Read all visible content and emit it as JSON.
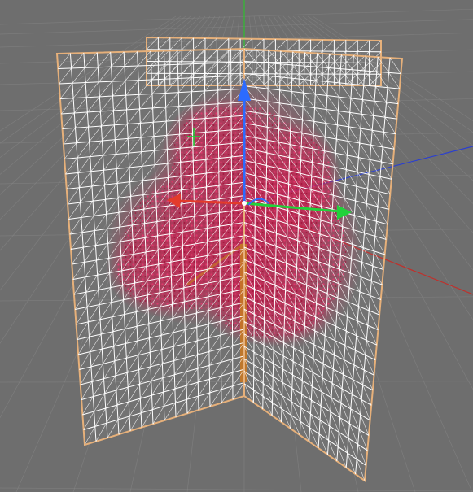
{
  "viewport": {
    "projection": "perspective",
    "background_color": "#6e6e6e",
    "floor_grid": true,
    "floor_grid_color": "#8a8a8a",
    "scene_axes": {
      "x_color": "#c0302b",
      "y_color": "#2fbf2f",
      "z_color": "#2b3fd0"
    }
  },
  "object": {
    "type": "tree-foliage-billboard-cross",
    "planes": 2,
    "selection_outline_color": "#e6b07a",
    "wireframe_color": "#ffffff",
    "foliage_color": "#c8184a",
    "trunk_color": "#c4731e"
  },
  "gizmo": {
    "type": "move-tool",
    "x_handle_color": "#e33b2b",
    "y_handle_color": "#2c6bff",
    "z_handle_color": "#22d13a",
    "icons": [
      "x-arrow-icon",
      "y-arrow-icon",
      "z-arrow-icon",
      "rotation-arc-icon"
    ]
  }
}
